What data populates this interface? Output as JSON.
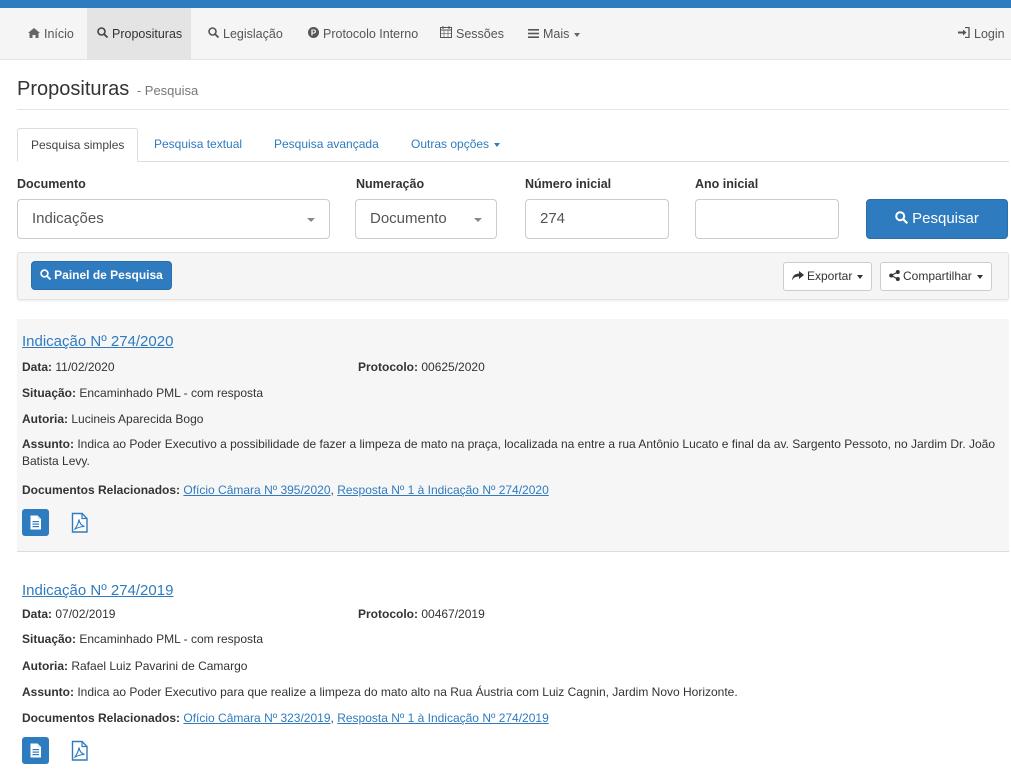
{
  "navbar": {
    "items": [
      {
        "label": "Início",
        "icon": "home-icon",
        "active": false
      },
      {
        "label": "Proposituras",
        "icon": "search-icon",
        "active": true
      },
      {
        "label": "Legislação",
        "icon": "search-icon",
        "active": false
      },
      {
        "label": "Protocolo Interno",
        "icon": "circle-p-icon",
        "active": false
      },
      {
        "label": "Sessões",
        "icon": "calendar-icon",
        "active": false
      },
      {
        "label": "Mais",
        "icon": "menu-icon",
        "active": false
      }
    ],
    "login_label": "Login"
  },
  "page": {
    "title": "Proposituras",
    "subtitle": "- Pesquisa"
  },
  "tabs": [
    {
      "label": "Pesquisa simples",
      "active": true
    },
    {
      "label": "Pesquisa textual",
      "active": false
    },
    {
      "label": "Pesquisa avançada",
      "active": false
    },
    {
      "label": "Outras opções",
      "active": false
    }
  ],
  "form": {
    "documento_label": "Documento",
    "documento_value": "Indicações",
    "numeracao_label": "Numeração",
    "numeracao_value": "Documento",
    "numero_label": "Número inicial",
    "numero_value": "274",
    "ano_label": "Ano inicial",
    "ano_value": "",
    "search_button": "Pesquisar"
  },
  "toolbar": {
    "panel_button": "Painel de Pesquisa",
    "export_button": "Exportar",
    "share_button": "Compartilhar"
  },
  "labels": {
    "data": "Data:",
    "protocolo": "Protocolo:",
    "situacao": "Situação:",
    "autoria": "Autoria:",
    "assunto": "Assunto:",
    "docs_rel": "Documentos Relacionados:"
  },
  "results": [
    {
      "title": "Indicação Nº 274/2020",
      "data": "11/02/2020",
      "protocolo": "00625/2020",
      "situacao": "Encaminhado PML - com resposta",
      "autoria": "Lucineis Aparecida Bogo",
      "assunto": "Indica ao Poder Executivo a possibilidade de fazer a limpeza de mato na praça, localizada na entre a rua Antônio Lucato e final da av. Sargento Pessoto, no Jardim Dr. João Batista Levy.",
      "doc_link_1": "Ofício Câmara Nº 395/2020",
      "doc_sep": ",",
      "doc_link_2": "Resposta Nº 1 à Indicação Nº 274/2020"
    },
    {
      "title": "Indicação Nº 274/2019",
      "data": "07/02/2019",
      "protocolo": "00467/2019",
      "situacao": "Encaminhado PML - com resposta",
      "autoria": "Rafael Luiz Pavarini de Camargo",
      "assunto": "Indica ao Poder Executivo para que realize a limpeza do mato alto na Rua Áustria com Luiz Cagnin, Jardim Novo Horizonte.",
      "doc_link_1": "Ofício Câmara Nº 323/2019",
      "doc_sep": ",",
      "doc_link_2": "Resposta Nº 1 à Indicação Nº 274/2019"
    }
  ],
  "colors": {
    "brand": "#2f7bbf",
    "navbar_bg": "#f5f5f5",
    "result_bg": "#f6f6f6"
  }
}
